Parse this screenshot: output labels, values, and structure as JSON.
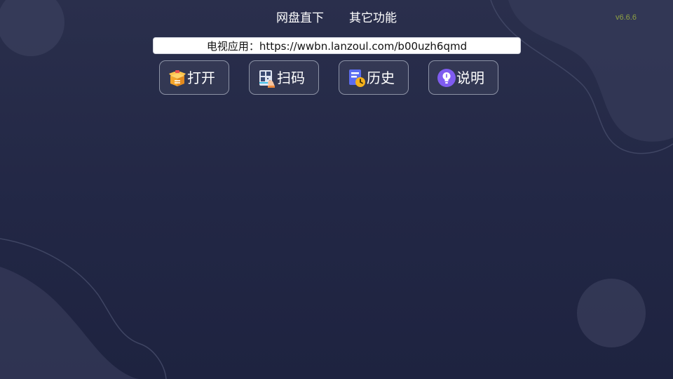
{
  "tabs": [
    {
      "label": "网盘直下"
    },
    {
      "label": "其它功能"
    }
  ],
  "version": "v6.6.6",
  "url_bar": {
    "value": "电视应用：https://wwbn.lanzoul.com/b00uzh6qmd"
  },
  "buttons": [
    {
      "label": "打开",
      "icon": "open-box-icon"
    },
    {
      "label": "扫码",
      "icon": "qr-scan-icon"
    },
    {
      "label": "历史",
      "icon": "history-icon"
    },
    {
      "label": "说明",
      "icon": "lightbulb-info-icon"
    }
  ],
  "colors": {
    "background": "#252a47",
    "version_text": "#8fa243",
    "button_border": "#8d93a6"
  }
}
